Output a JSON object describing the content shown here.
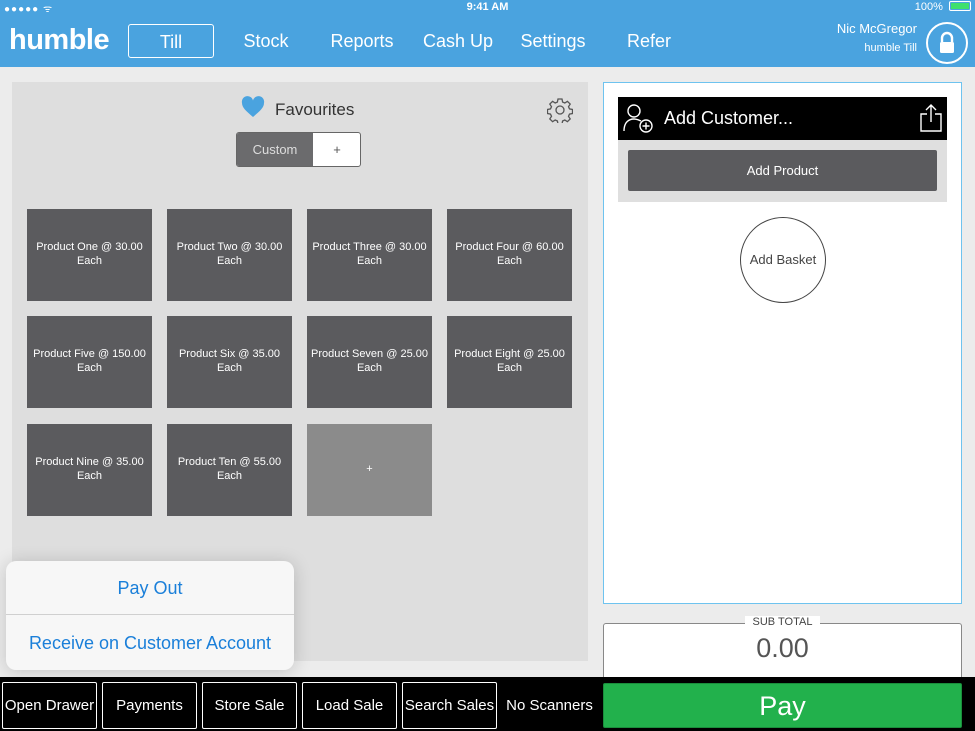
{
  "status_bar": {
    "signal": "●●●●● ᯤ",
    "time": "9:41 AM",
    "battery": "100%"
  },
  "header": {
    "logo": "humble",
    "nav": [
      "Till",
      "Stock",
      "Reports",
      "Cash Up",
      "Settings",
      "Refer"
    ],
    "active_nav": "Till",
    "user_name": "Nic McGregor",
    "user_device": "humble Till"
  },
  "favourites": {
    "title": "Favourites",
    "segment_custom": "Custom",
    "segment_add": "+",
    "products": [
      "Product One @ 30.00 Each",
      "Product Two @ 30.00 Each",
      "Product Three @ 30.00 Each",
      "Product Four @ 60.00 Each",
      "Product Five @ 150.00 Each",
      "Product Six @ 35.00 Each",
      "Product Seven @ 25.00 Each",
      "Product Eight @ 25.00 Each",
      "Product Nine @ 35.00 Each",
      "Product Ten @ 55.00 Each"
    ],
    "add_tile": "+"
  },
  "basket": {
    "add_customer": "Add Customer...",
    "add_product": "Add Product",
    "add_basket": "Add Basket",
    "subtotal_label": "SUB TOTAL",
    "subtotal_value": "0.00"
  },
  "bottom_bar": {
    "open_drawer": "Open Drawer",
    "payments": "Payments",
    "store_sale": "Store Sale",
    "load_sale": "Load Sale",
    "search_sales": "Search Sales",
    "no_scanners": "No Scanners",
    "pay": "Pay"
  },
  "popover": {
    "pay_out": "Pay Out",
    "receive_on_account": "Receive on Customer Account"
  },
  "colors": {
    "header": "#4aa3df",
    "tile": "#5b5b5e",
    "pay": "#22b14c",
    "popover_text": "#1a7fd9",
    "heart": "#4aa3df"
  },
  "icons": [
    "wifi-icon",
    "battery-icon",
    "lock-icon",
    "heart-icon",
    "gear-icon",
    "add-customer-icon",
    "share-icon"
  ]
}
